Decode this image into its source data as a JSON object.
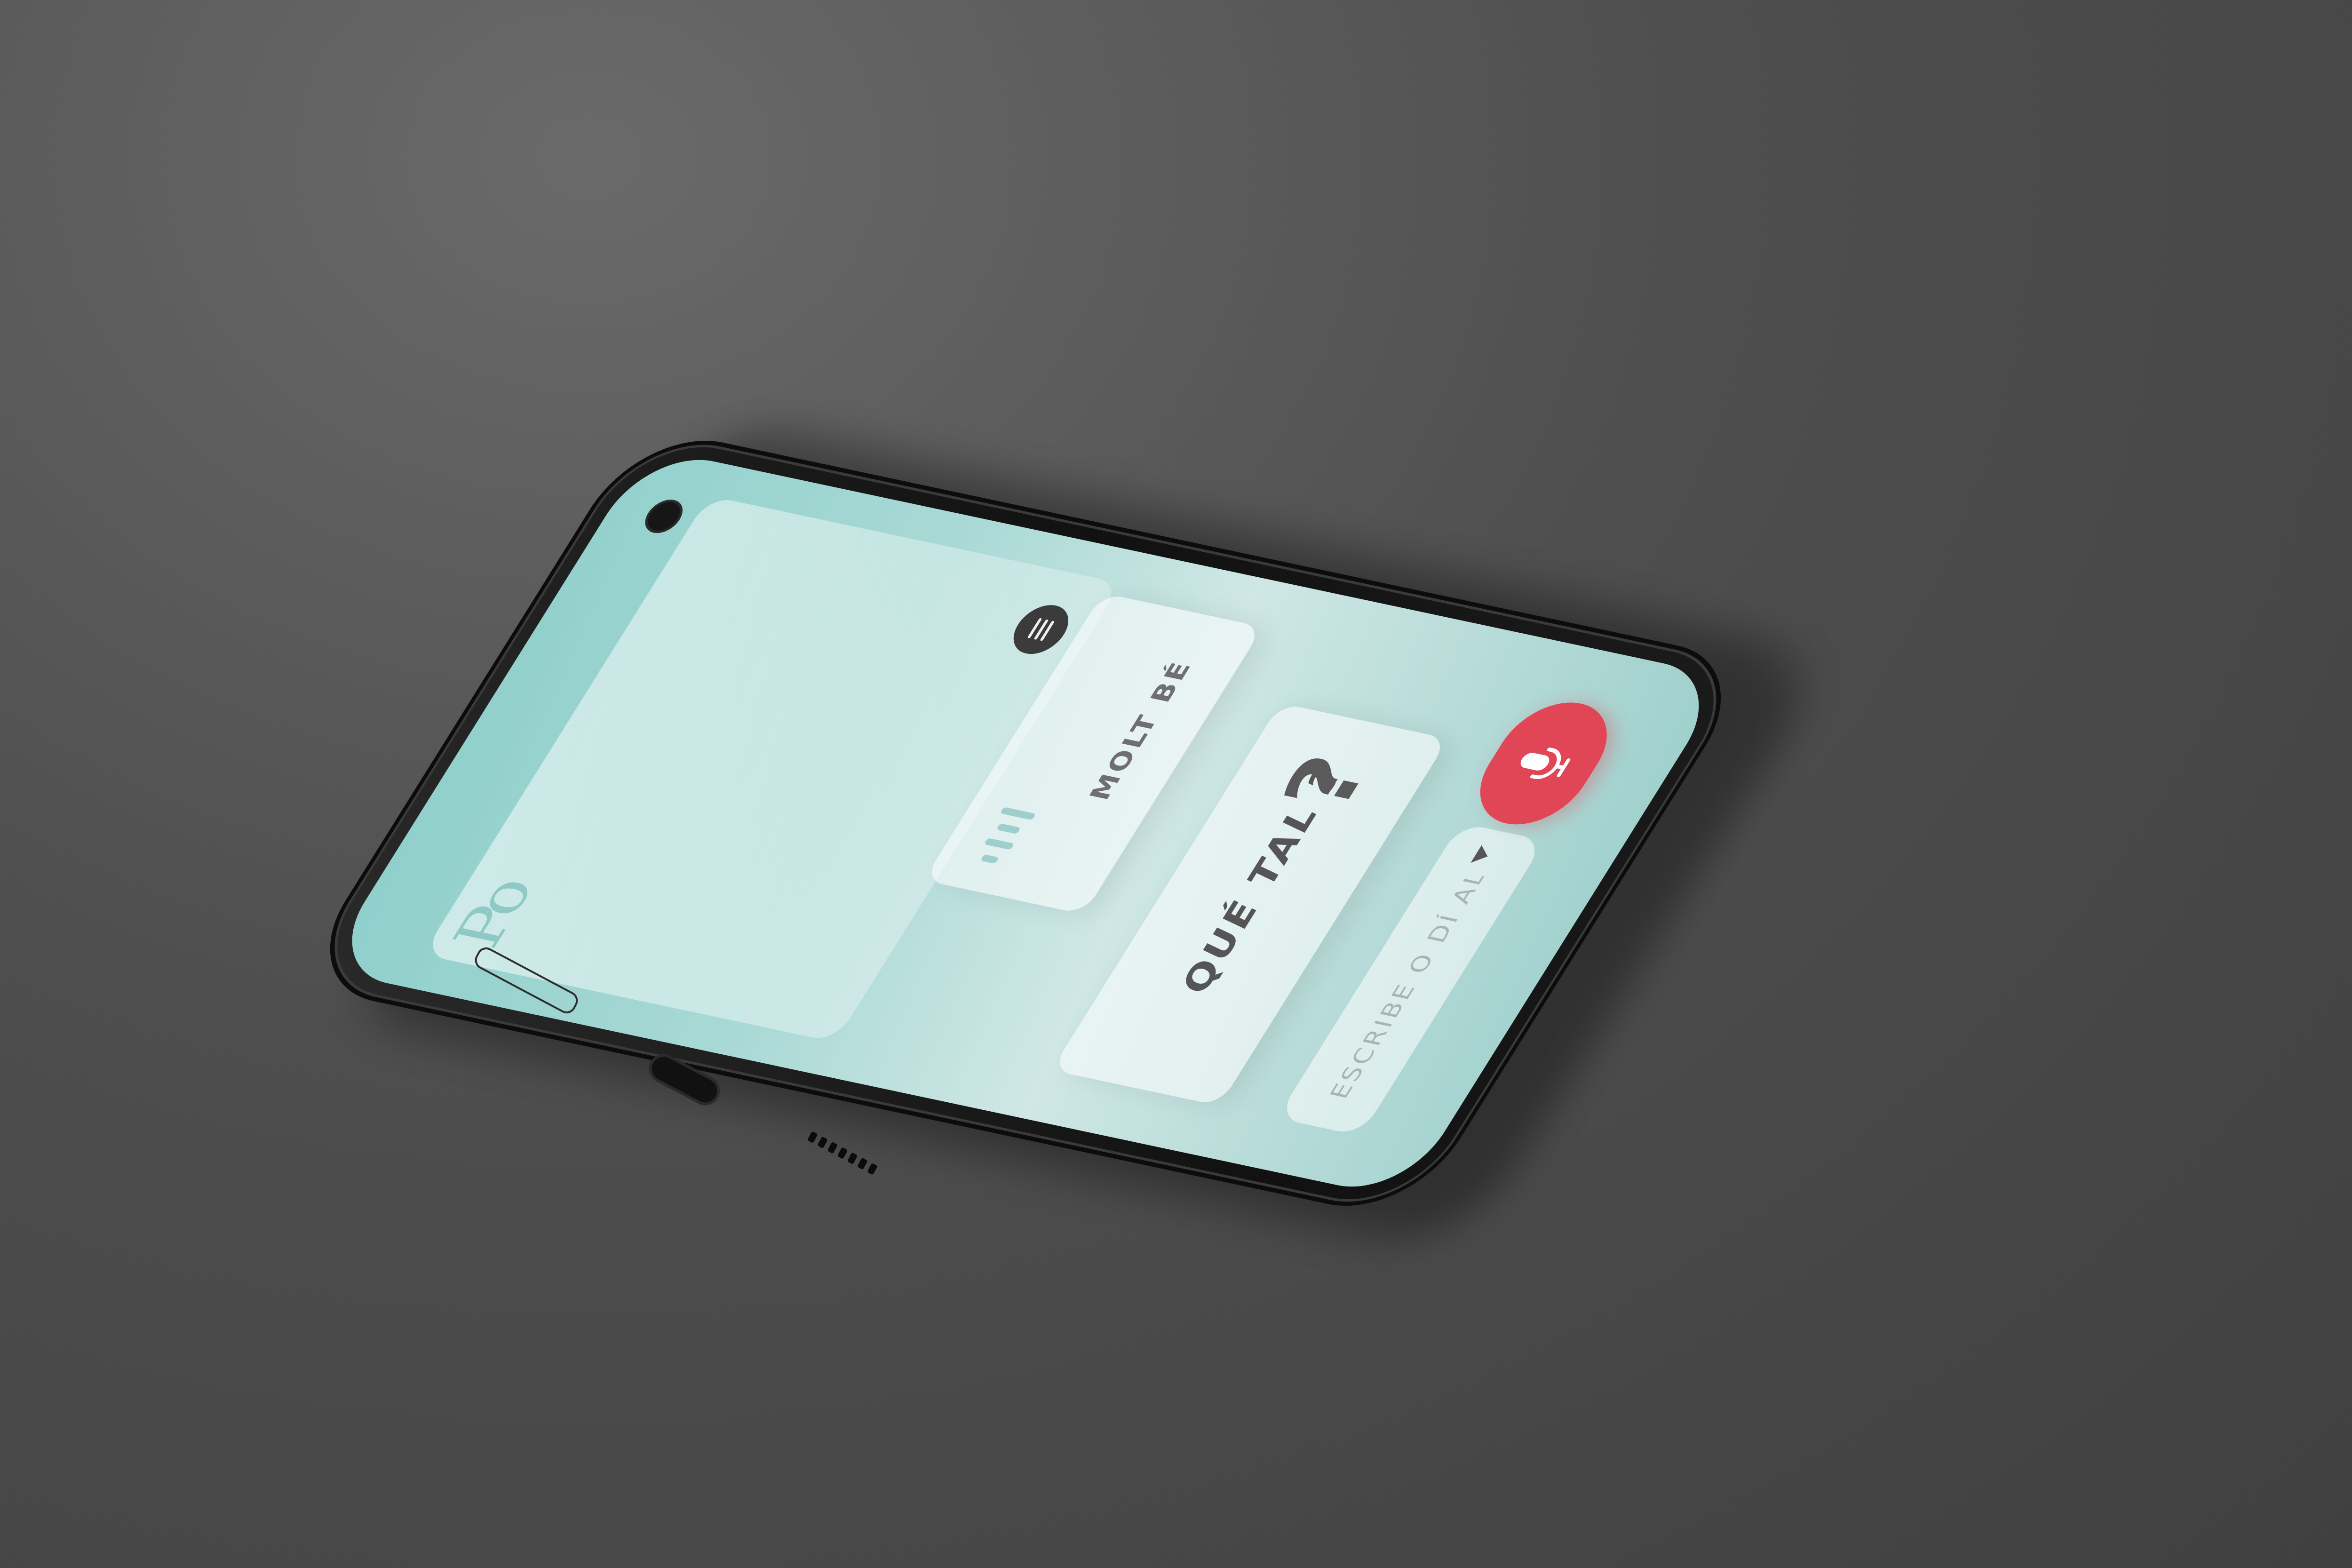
{
  "app": {
    "logo_text": "Ро"
  },
  "chat": {
    "reply_text": "MOLT BÉ",
    "question_text": "QUÉ TAL ?",
    "question_mark": "?"
  },
  "composer": {
    "placeholder": "ESCRIBE O DÍ ALGO"
  },
  "icons": {
    "menu": "menu-icon",
    "microphone": "microphone-icon",
    "audio_wave": "audio-wave-icon",
    "dropdown": "dropdown-arrow-icon"
  },
  "colors": {
    "screen_teal": "#9fd0cc",
    "mic_button_red": "#e04656",
    "menu_button_dark": "#3b3b3b",
    "background_gray": "#4e4e4e"
  }
}
